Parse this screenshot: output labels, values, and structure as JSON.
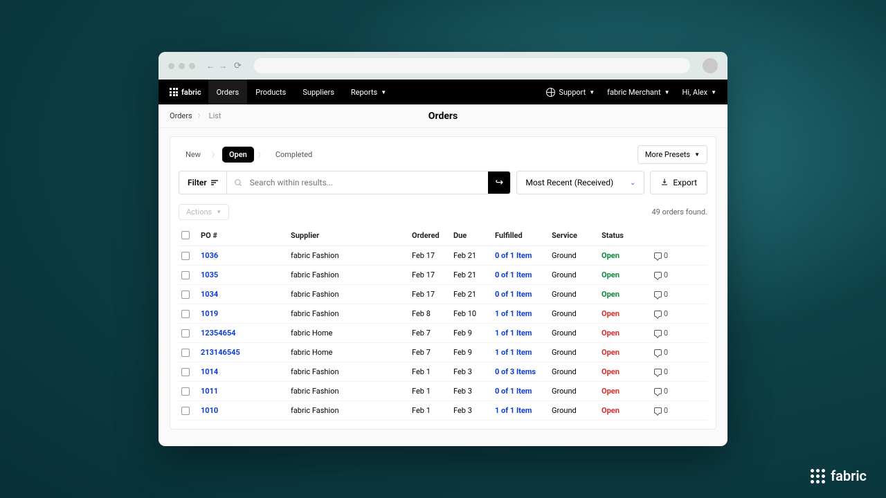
{
  "brand": "fabric",
  "nav": {
    "items": [
      "Orders",
      "Products",
      "Suppliers",
      "Reports"
    ],
    "active": "Orders"
  },
  "header_right": {
    "support": "Support",
    "merchant": "fabric Merchant",
    "greeting": "Hi, Alex"
  },
  "breadcrumb": {
    "first": "Orders",
    "second": "List"
  },
  "page_title": "Orders",
  "presets": {
    "new": "New",
    "open": "Open",
    "completed": "Completed",
    "more": "More Presets"
  },
  "filter": {
    "label": "Filter",
    "placeholder": "Search within results...",
    "sort": "Most Recent (Received)",
    "export": "Export"
  },
  "actions": {
    "label": "Actions",
    "count": "49 orders found."
  },
  "columns": {
    "po": "PO #",
    "supplier": "Supplier",
    "ordered": "Ordered",
    "due": "Due",
    "fulfilled": "Fulfilled",
    "service": "Service",
    "status": "Status"
  },
  "rows": [
    {
      "po": "1036",
      "supplier": "fabric Fashion",
      "ordered": "Feb 17",
      "due": "Feb 21",
      "fulfilled": "0 of 1 Item",
      "service": "Ground",
      "status": "Open",
      "status_kind": "green",
      "msgs": "0"
    },
    {
      "po": "1035",
      "supplier": "fabric Fashion",
      "ordered": "Feb 17",
      "due": "Feb 21",
      "fulfilled": "0 of 1 Item",
      "service": "Ground",
      "status": "Open",
      "status_kind": "green",
      "msgs": "0"
    },
    {
      "po": "1034",
      "supplier": "fabric Fashion",
      "ordered": "Feb 17",
      "due": "Feb 21",
      "fulfilled": "0 of 1 Item",
      "service": "Ground",
      "status": "Open",
      "status_kind": "green",
      "msgs": "0"
    },
    {
      "po": "1019",
      "supplier": "fabric Fashion",
      "ordered": "Feb 8",
      "due": "Feb 10",
      "fulfilled": "1 of 1 Item",
      "service": "Ground",
      "status": "Open",
      "status_kind": "red",
      "msgs": "0"
    },
    {
      "po": "12354654",
      "supplier": "fabric Home",
      "ordered": "Feb 7",
      "due": "Feb 9",
      "fulfilled": "1 of 1 Item",
      "service": "Ground",
      "status": "Open",
      "status_kind": "red",
      "msgs": "0"
    },
    {
      "po": "213146545",
      "supplier": "fabric Home",
      "ordered": "Feb 7",
      "due": "Feb 9",
      "fulfilled": "1 of 1 Item",
      "service": "Ground",
      "status": "Open",
      "status_kind": "red",
      "msgs": "0"
    },
    {
      "po": "1014",
      "supplier": "fabric Fashion",
      "ordered": "Feb 1",
      "due": "Feb 3",
      "fulfilled": "0 of 3 Items",
      "service": "Ground",
      "status": "Open",
      "status_kind": "red",
      "msgs": "0"
    },
    {
      "po": "1011",
      "supplier": "fabric Fashion",
      "ordered": "Feb 1",
      "due": "Feb 3",
      "fulfilled": "0 of 1 Item",
      "service": "Ground",
      "status": "Open",
      "status_kind": "red",
      "msgs": "0"
    },
    {
      "po": "1010",
      "supplier": "fabric Fashion",
      "ordered": "Feb 1",
      "due": "Feb 3",
      "fulfilled": "1 of 1 Item",
      "service": "Ground",
      "status": "Open",
      "status_kind": "red",
      "msgs": "0"
    }
  ]
}
